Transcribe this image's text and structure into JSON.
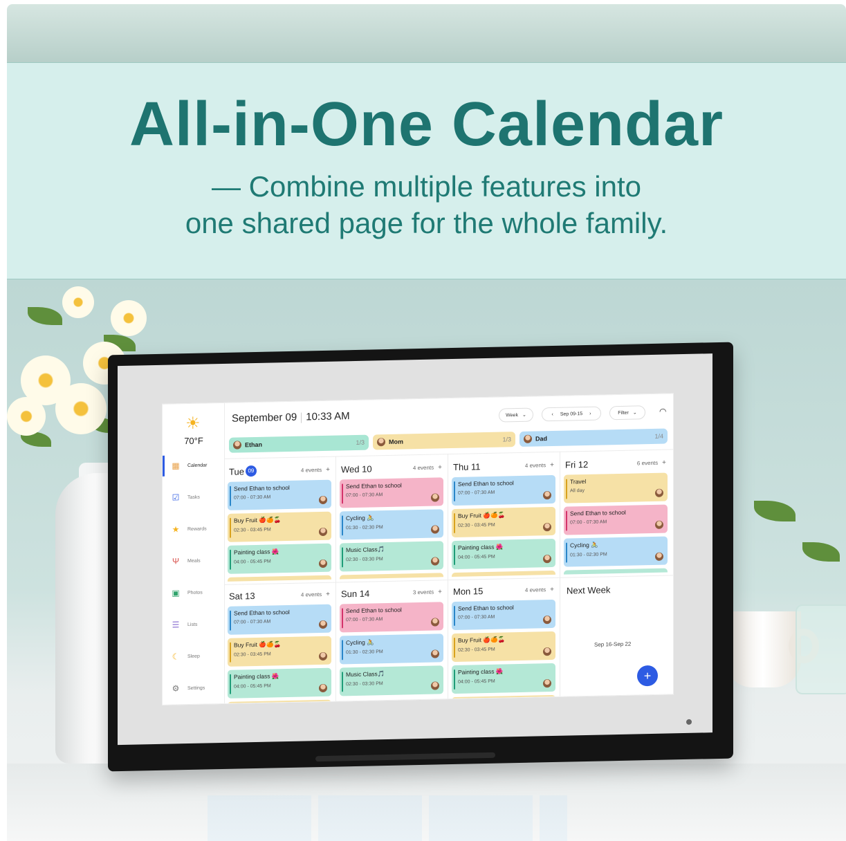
{
  "headline": {
    "title": "All-in-One Calendar",
    "subtitle_line1": "— Combine multiple features into",
    "subtitle_line2": "one shared page for the whole family."
  },
  "sidebar": {
    "weather_icon": "sun-icon",
    "temperature": "70°F",
    "items": [
      {
        "label": "Calendar",
        "icon": "calendar-icon",
        "active": true
      },
      {
        "label": "Tasks",
        "icon": "checkbox-icon",
        "active": false
      },
      {
        "label": "Rewards",
        "icon": "star-icon",
        "active": false
      },
      {
        "label": "Meals",
        "icon": "cutlery-icon",
        "active": false
      },
      {
        "label": "Photos",
        "icon": "photo-icon",
        "active": false
      },
      {
        "label": "Lists",
        "icon": "list-icon",
        "active": false
      },
      {
        "label": "Sleep",
        "icon": "moon-icon",
        "active": false
      },
      {
        "label": "Settings",
        "icon": "gear-icon",
        "active": false
      }
    ]
  },
  "header": {
    "date": "September 09",
    "time": "10:33 AM",
    "view_select": "Week",
    "range": "Sep 09-15",
    "filter": "Filter"
  },
  "people": [
    {
      "name": "Ethan",
      "count": "1/3",
      "color": "#a8e6d3"
    },
    {
      "name": "Mom",
      "count": "1/3",
      "color": "#f6e1a6"
    },
    {
      "name": "Dad",
      "count": "1/4",
      "color": "#b6dcf6"
    }
  ],
  "days": [
    {
      "name": "Tue",
      "badge": "09",
      "count": "4 events",
      "events": [
        {
          "title": "Send Ethan to school",
          "time": "07:00 - 07:30 AM",
          "color": "blue"
        },
        {
          "title": "Buy Fruit 🍎🍊🍒",
          "time": "02:30 - 03:45 PM",
          "color": "yellow"
        },
        {
          "title": "Painting class 🌺",
          "time": "04:00 - 05:45 PM",
          "color": "green"
        }
      ],
      "peek": "yellow"
    },
    {
      "name": "Wed 10",
      "badge": "",
      "count": "4 events",
      "events": [
        {
          "title": "Send Ethan to school",
          "time": "07:00 - 07:30 AM",
          "color": "pink"
        },
        {
          "title": "Cycling 🚴",
          "time": "01:30 - 02:30 PM",
          "color": "blue"
        },
        {
          "title": "Music Class🎵",
          "time": "02:30 - 03:30 PM",
          "color": "green"
        }
      ],
      "peek": "yellow"
    },
    {
      "name": "Thu 11",
      "badge": "",
      "count": "4 events",
      "events": [
        {
          "title": "Send Ethan to school",
          "time": "07:00 - 07:30 AM",
          "color": "blue"
        },
        {
          "title": "Buy Fruit 🍎🍊🍒",
          "time": "02:30 - 03:45 PM",
          "color": "yellow"
        },
        {
          "title": "Painting class 🌺",
          "time": "04:00 - 05:45 PM",
          "color": "green"
        }
      ],
      "peek": "yellow"
    },
    {
      "name": "Fri 12",
      "badge": "",
      "count": "6 events",
      "events": [
        {
          "title": "Travel",
          "time": "All day",
          "color": "yellow"
        },
        {
          "title": "Send Ethan to school",
          "time": "07:00 - 07:30 AM",
          "color": "pink"
        },
        {
          "title": "Cycling 🚴",
          "time": "01:30 - 02:30 PM",
          "color": "blue"
        }
      ],
      "peek": "green"
    },
    {
      "name": "Sat 13",
      "badge": "",
      "count": "4 events",
      "events": [
        {
          "title": "Send Ethan to school",
          "time": "07:00 - 07:30 AM",
          "color": "blue"
        },
        {
          "title": "Buy Fruit 🍎🍊🍒",
          "time": "02:30 - 03:45 PM",
          "color": "yellow"
        },
        {
          "title": "Painting class 🌺",
          "time": "04:00 - 05:45 PM",
          "color": "green"
        }
      ],
      "peek": "yellow"
    },
    {
      "name": "Sun 14",
      "badge": "",
      "count": "3 events",
      "events": [
        {
          "title": "Send Ethan to school",
          "time": "07:00 - 07:30 AM",
          "color": "pink"
        },
        {
          "title": "Cycling 🚴",
          "time": "01:30 - 02:30 PM",
          "color": "blue"
        },
        {
          "title": "Music Class🎵",
          "time": "02:30 - 03:30 PM",
          "color": "green"
        }
      ],
      "peek": ""
    },
    {
      "name": "Mon 15",
      "badge": "",
      "count": "4 events",
      "events": [
        {
          "title": "Send Ethan to school",
          "time": "07:00 - 07:30 AM",
          "color": "blue"
        },
        {
          "title": "Buy Fruit 🍎🍊🍒",
          "time": "02:30 - 03:45 PM",
          "color": "yellow"
        },
        {
          "title": "Painting class 🌺",
          "time": "04:00 - 05:45 PM",
          "color": "green"
        }
      ],
      "peek": "yellow"
    }
  ],
  "next_week": {
    "title": "Next Week",
    "range": "Sep 16-Sep 22"
  },
  "colors": {
    "accent": "#2d5be3",
    "headline": "#1e7470"
  }
}
